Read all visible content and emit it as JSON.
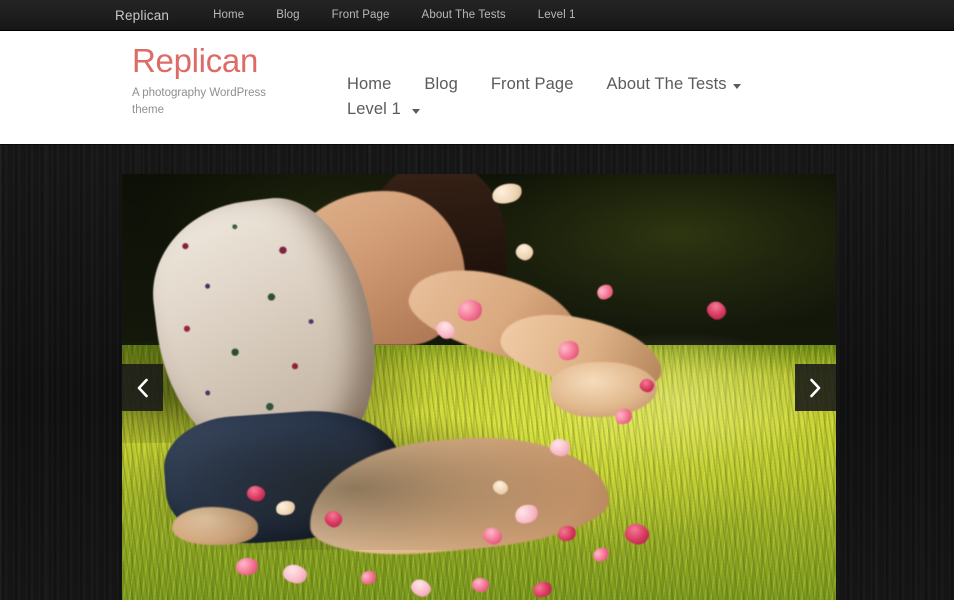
{
  "admin_bar": {
    "site_name": "Replican",
    "items": [
      {
        "label": "Home"
      },
      {
        "label": "Blog"
      },
      {
        "label": "Front Page"
      },
      {
        "label": "About The Tests"
      },
      {
        "label": "Level 1"
      }
    ]
  },
  "header": {
    "site_title": "Replican",
    "site_description": "A photography WordPress theme",
    "title_color": "#dd6b66",
    "nav": [
      {
        "label": "Home",
        "has_submenu": false
      },
      {
        "label": "Blog",
        "has_submenu": false
      },
      {
        "label": "Front Page",
        "has_submenu": false
      },
      {
        "label": "About The Tests",
        "has_submenu": true
      },
      {
        "label": "Level 1",
        "has_submenu": true
      }
    ]
  },
  "slider": {
    "prev_label": "Previous slide",
    "next_label": "Next slide",
    "prev_icon": "chevron-left-icon",
    "next_icon": "chevron-right-icon",
    "slide_alt": "Woman kneeling on sunlit grass tossing pink flower petals"
  }
}
